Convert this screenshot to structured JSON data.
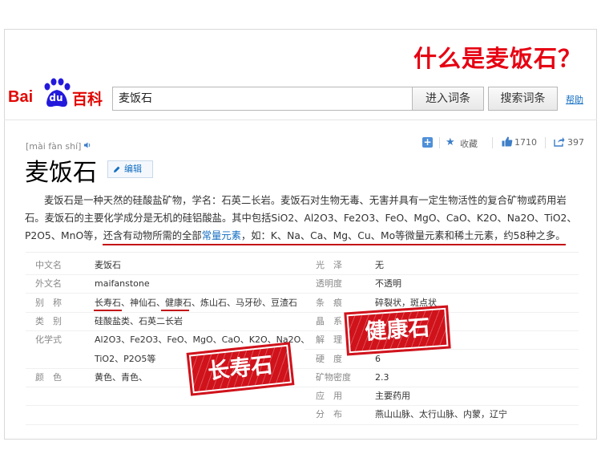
{
  "headline": "什么是麦饭石？",
  "logo": {
    "bai": "Bai",
    "du": "du",
    "baike": "百科"
  },
  "search": {
    "value": "麦饭石",
    "enter_label": "进入词条",
    "search_label": "搜索词条",
    "help_label": "帮助"
  },
  "entry": {
    "pinyin": "[mài fàn shí]",
    "title": "麦饭石",
    "edit_label": "编辑",
    "favorite_label": "收藏",
    "like_count": "1710",
    "share_count": "397"
  },
  "summary": {
    "part1": "麦饭石是一种天然的硅酸盐矿物，学名：石英二长岩。麦饭石对生物无毒、无害并具有一定生物活性的复合矿物或药用岩石。麦饭石的主要化学成分是无机的硅铝酸盐。其中包括SiO2、Al2O3、Fe2O3、FeO、MgO、CaO、K2O、Na2O、TiO2、P2O5、MnO等，还含有动物所需的全部",
    "link": "常量元素",
    "part2": "，如：K、Na、Ca、Mg、Cu、Mo等微量元素和稀土元素，约58种之多。"
  },
  "info_left": [
    {
      "key": "中文名",
      "value": "麦饭石"
    },
    {
      "key": "外文名",
      "value": "maifanstone"
    },
    {
      "key": "别　称",
      "value": "长寿石、神仙石、健康石、炼山石、马牙砂、豆渣石"
    },
    {
      "key": "类　别",
      "value": "硅酸盐类、石英二长岩"
    },
    {
      "key": "化学式",
      "value": "Al2O3、Fe2O3、FeO、MgO、CaO、K2O、Na2O、"
    },
    {
      "key": "",
      "value": "TiO2、P2O5等"
    },
    {
      "key": "颜　色",
      "value": "黄色、青色、"
    }
  ],
  "info_right": [
    {
      "key": "光　泽",
      "value": "无"
    },
    {
      "key": "透明度",
      "value": "不透明"
    },
    {
      "key": "条　痕",
      "value": "碎裂状，斑点状"
    },
    {
      "key": "晶　系",
      "value": ""
    },
    {
      "key": "解　理",
      "value": ""
    },
    {
      "key": "硬　度",
      "value": "6"
    },
    {
      "key": "矿物密度",
      "value": "2.3"
    },
    {
      "key": "应　用",
      "value": "主要药用"
    },
    {
      "key": "分　布",
      "value": "燕山山脉、太行山脉、内蒙，辽宁"
    }
  ],
  "stamps": {
    "longevity": "长寿石",
    "health": "健康石"
  },
  "colors": {
    "accent_red": "#e60012",
    "link_blue": "#136ec2",
    "stamp_red": "#d0121b"
  }
}
